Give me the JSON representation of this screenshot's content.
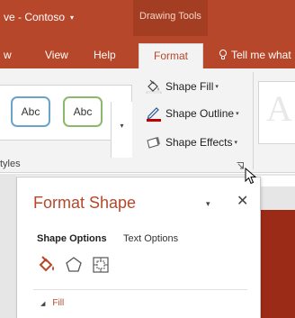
{
  "titlebar": {
    "title": "ve - Contoso",
    "title_caret": "▾",
    "contextual_group": "Drawing Tools"
  },
  "tabs": {
    "items": [
      "w",
      "View",
      "Help"
    ],
    "active": "Format",
    "tell_me": "Tell me what"
  },
  "ribbon": {
    "style_swatch_1": "Abc",
    "style_swatch_2": "Abc",
    "more_glyph": "▾",
    "group_label": "tyles",
    "shape_fill": "Shape Fill",
    "shape_outline": "Shape Outline",
    "shape_effects": "Shape Effects",
    "dropdown_glyph": "▾",
    "wordart_letter": "A"
  },
  "pane": {
    "title": "Format Shape",
    "menu_glyph": "▾",
    "close_glyph": "✕",
    "tab_shape_options": "Shape Options",
    "tab_text_options": "Text Options",
    "section_fill": "Fill",
    "collapse_glyph": "◢"
  },
  "colors": {
    "accent": "#b7472a",
    "contextual": "#a33e23",
    "slide": "#9b2a17",
    "outline_red": "#c00000",
    "swatch_blue": "#6aa4c9",
    "swatch_green": "#8cb86c"
  },
  "icons": [
    "lightbulb-icon",
    "paint-bucket-icon",
    "pencil-outline-icon",
    "shape-effects-icon",
    "dialog-launcher-icon",
    "fill-line-icon",
    "pentagon-effects-icon",
    "size-properties-icon",
    "mouse-cursor-icon"
  ]
}
